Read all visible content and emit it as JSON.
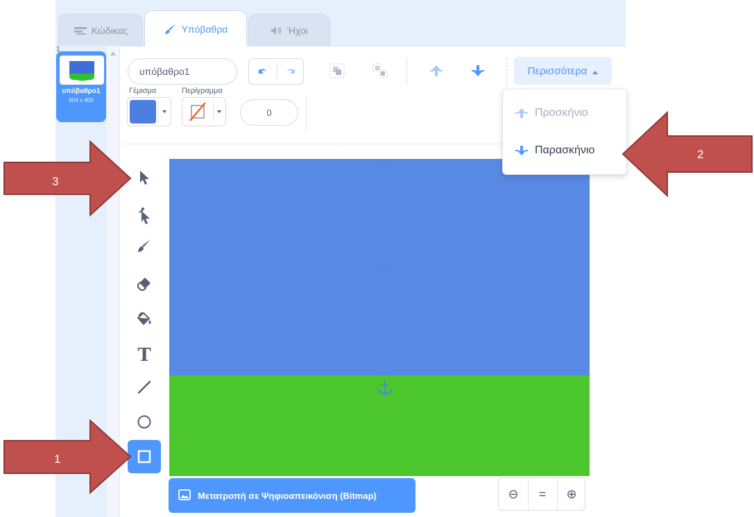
{
  "tabs": [
    {
      "label": "Κώδικας",
      "icon": "code-icon"
    },
    {
      "label": "Υπόβαθρα",
      "icon": "brush-icon",
      "active": true
    },
    {
      "label": "Ήχοι",
      "icon": "sound-icon"
    }
  ],
  "costume": {
    "index": "1",
    "name": "υπόβαθρο1",
    "size": "604 x 400"
  },
  "toolbar": {
    "name_value": "υπόβαθρο1",
    "fill_label": "Γέμισμα",
    "outline_label": "Περίγραμμα",
    "outline_width": "0",
    "fill_color": "#4d7fe0",
    "more_label": "Περισσότερα"
  },
  "more_menu": {
    "items": [
      {
        "label": "Προσκήνιο",
        "enabled": false
      },
      {
        "label": "Παρασκήνιο",
        "enabled": true
      }
    ]
  },
  "tools": [
    "select",
    "reshape",
    "brush",
    "eraser",
    "fill",
    "text",
    "line",
    "circle",
    "rectangle"
  ],
  "selected_tool": "rectangle",
  "canvas": {
    "sky_color": "#5889e5",
    "ground_color": "#4cc72e"
  },
  "bitmap_button": "Μετατροπή σε Ψηφιοαπεικόνιση (Bitmap)",
  "zoom": {
    "out": "⊖",
    "reset": "=",
    "in": "⊕"
  },
  "annotations": [
    "1",
    "2",
    "3"
  ]
}
